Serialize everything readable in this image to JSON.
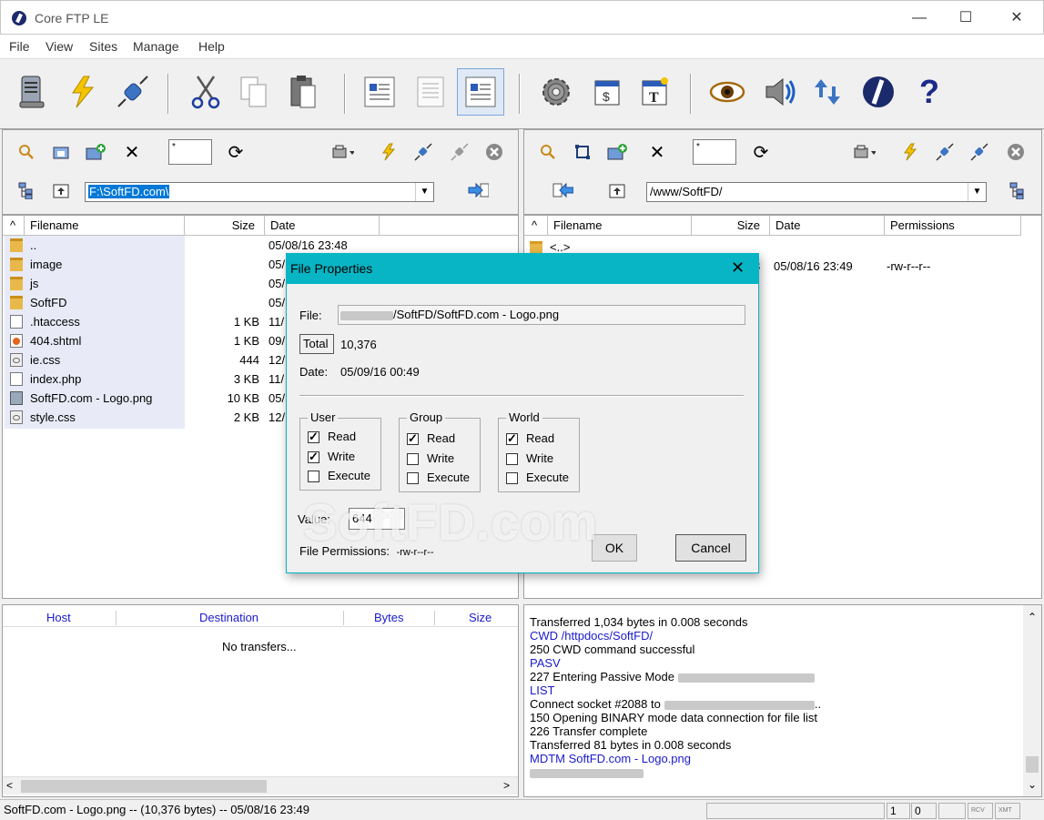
{
  "window": {
    "title": "Core FTP LE",
    "minimize": "—",
    "maximize": "☐",
    "close": "✕"
  },
  "menu": [
    "File",
    "View",
    "Sites",
    "Manage",
    "Help"
  ],
  "toolbar_icons": [
    "site-manager-icon",
    "quick-connect-icon",
    "connect-icon",
    "cut-icon",
    "copy-icon",
    "paste-icon",
    "view-list-icon",
    "view-details-icon",
    "view-icons-icon",
    "settings-icon",
    "scheduler-icon",
    "template-icon",
    "view-icon",
    "sound-icon",
    "transfer-icon",
    "coreftp-logo-icon",
    "help-icon"
  ],
  "local_pane": {
    "filter": "*",
    "path_selected": "F:\\SoftFD.com\\",
    "columns": [
      "Filename",
      "Size",
      "Date"
    ],
    "sort_indicator": "^",
    "files": [
      {
        "name": "..",
        "size": "",
        "date": "05/08/16  23:48",
        "icon": "folder"
      },
      {
        "name": "image",
        "size": "",
        "date": "05/",
        "icon": "folder"
      },
      {
        "name": "js",
        "size": "",
        "date": "05/",
        "icon": "folder"
      },
      {
        "name": "SoftFD",
        "size": "",
        "date": "05/",
        "icon": "folder"
      },
      {
        "name": ".htaccess",
        "size": "1 KB",
        "date": "11/",
        "icon": "doc"
      },
      {
        "name": "404.shtml",
        "size": "1 KB",
        "date": "09/",
        "icon": "html"
      },
      {
        "name": "ie.css",
        "size": "444",
        "date": "12/",
        "icon": "css"
      },
      {
        "name": "index.php",
        "size": "3 KB",
        "date": "11/",
        "icon": "doc"
      },
      {
        "name": "SoftFD.com - Logo.png",
        "size": "10 KB",
        "date": "05/",
        "icon": "image"
      },
      {
        "name": "style.css",
        "size": "2 KB",
        "date": "12/",
        "icon": "css"
      }
    ]
  },
  "remote_pane": {
    "filter": "*",
    "path": "/www/SoftFD/",
    "columns": [
      "Filename",
      "Size",
      "Date",
      "Permissions"
    ],
    "sort_indicator": "^",
    "files": [
      {
        "name": "<..>",
        "size": "",
        "date": "",
        "perms": ""
      },
      {
        "name": "",
        "size": "8",
        "date": "05/08/16  23:49",
        "perms": "-rw-r--r--"
      }
    ]
  },
  "dialog": {
    "title": "File Properties",
    "file_label": "File:",
    "file_value": "/SoftFD/SoftFD.com - Logo.png",
    "total_label": "Total",
    "total_value": "10,376",
    "date_label": "Date:",
    "date_value": "05/09/16  00:49",
    "groups": [
      {
        "name": "User",
        "read": true,
        "write": true,
        "execute": false
      },
      {
        "name": "Group",
        "read": true,
        "write": false,
        "execute": false
      },
      {
        "name": "World",
        "read": true,
        "write": false,
        "execute": false
      }
    ],
    "read_label": "Read",
    "write_label": "Write",
    "execute_label": "Execute",
    "value_label": "Value:",
    "value": "644",
    "perms_label": "File Permissions:",
    "perms_value": "-rw-r--r--",
    "ok": "OK",
    "cancel": "Cancel",
    "watermark": "SoftFD.com"
  },
  "transfers": {
    "columns": [
      "Host",
      "Destination",
      "Bytes",
      "Size"
    ],
    "empty_text": "No transfers..."
  },
  "log": [
    {
      "text": "Transferred 1,034 bytes in 0.008 seconds",
      "cls": ""
    },
    {
      "text": "CWD /httpdocs/SoftFD/",
      "cls": "blue"
    },
    {
      "text": "250 CWD command successful",
      "cls": ""
    },
    {
      "text": "PASV",
      "cls": "blue"
    },
    {
      "text": "227 Entering Passive Mode",
      "cls": "",
      "blur": 150
    },
    {
      "text": "LIST",
      "cls": "blue"
    },
    {
      "text": "Connect socket #2088 to",
      "cls": "",
      "blur": 165,
      "tail": ".."
    },
    {
      "text": "150 Opening BINARY mode data connection for file list",
      "cls": ""
    },
    {
      "text": "226 Transfer complete",
      "cls": ""
    },
    {
      "text": "Transferred 81 bytes in 0.008 seconds",
      "cls": ""
    },
    {
      "text": "MDTM SoftFD.com - Logo.png",
      "cls": "blue"
    },
    {
      "text": "",
      "cls": "",
      "blur": 125
    }
  ],
  "status": {
    "text": "SoftFD.com - Logo.png -- (10,376 bytes) -- 05/08/16  23:49",
    "cell1": "1",
    "cell2": "0",
    "rcv": "RCV",
    "xmt": "XMT"
  }
}
